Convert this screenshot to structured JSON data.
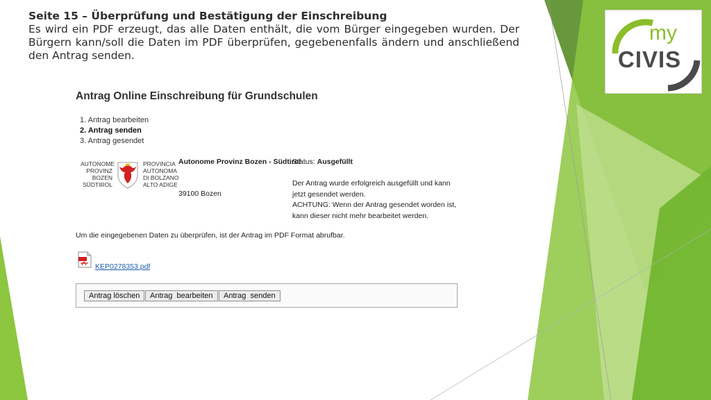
{
  "slide": {
    "title": "Seite 15 – Überprüfung und Bestätigung der Einschreibung",
    "description": "Es wird ein PDF erzeugt, das alle Daten enthält, die vom Bürger eingegeben wurden. Der Bürgern kann/soll die Daten im PDF überprüfen, gegebenenfalls ändern und anschließend den Antrag senden."
  },
  "logo": {
    "top": "my",
    "bottom": "CIVIS",
    "accent_color": "#8bbd2a",
    "text_color": "#4a4a4a"
  },
  "app": {
    "title": "Antrag Online Einschreibung für Grundschulen",
    "steps": [
      "1. Antrag bearbeiten",
      "2. Antrag senden",
      "3. Antrag gesendet"
    ],
    "province_logo": {
      "de_lines": [
        "AUTONOME",
        "PROVINZ",
        "BOZEN",
        "SÜDTIROL"
      ],
      "it_lines": [
        "PROVINCIA",
        "AUTONOMA",
        "DI BOLZANO",
        "ALTO ADIGE"
      ]
    },
    "province_name": "Autonome Provinz Bozen - Südtirol",
    "status_label": "Status:",
    "status_value": "Ausgefüllt",
    "city": "39100 Bozen",
    "message_1": "Der Antrag wurde erfolgreich ausgefüllt und kann jetzt gesendet werden.",
    "message_2": "ACHTUNG: Wenn der Antrag gesendet worden ist, kann dieser nicht mehr bearbeitet werden.",
    "info_text": "Um die eingegebenen Daten zu überprüfen, ist der Antrag im PDF Format abrufbar.",
    "pdf_link": "KEP0278353.pdf",
    "buttons": {
      "delete": "Antrag löschen",
      "edit": "Antrag  bearbeiten",
      "send": "Antrag  senden"
    }
  },
  "colors": {
    "green_dark": "#5a8f2a",
    "green_mid": "#8dc63f",
    "green_light": "#c6e39a",
    "link": "#1a5bb0"
  }
}
